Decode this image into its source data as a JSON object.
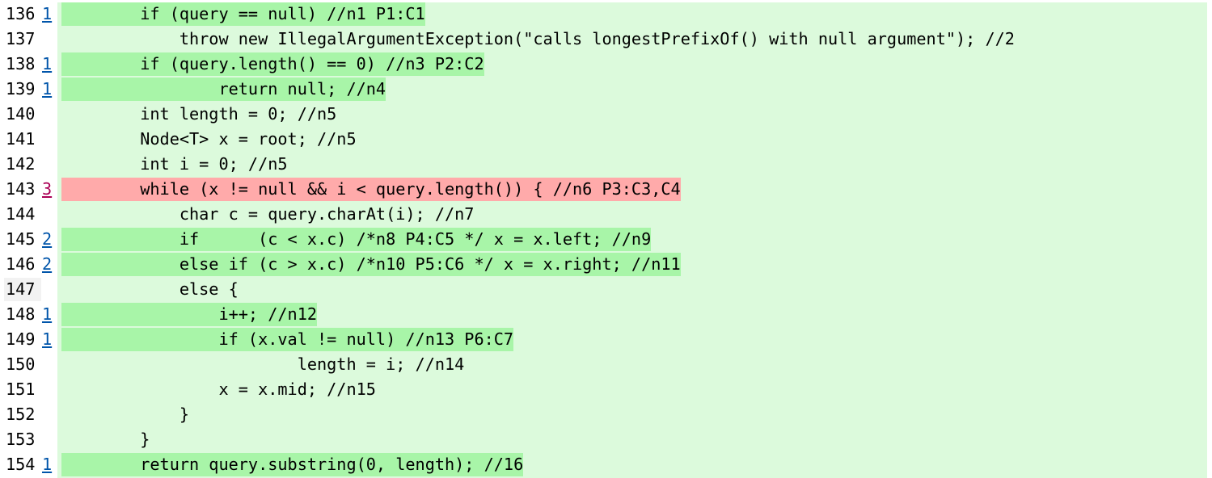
{
  "colors": {
    "line_background": "#dcfadc",
    "killed_highlight": "#a8f5a8",
    "survived_highlight": "#ffaaaa",
    "killed_link": "#0055aa",
    "survived_link": "#aa0055"
  },
  "lines": [
    {
      "number": "136",
      "mutations": "1",
      "status": "killed",
      "code": "        if (query == null) //n1 P1:C1"
    },
    {
      "number": "137",
      "mutations": "",
      "status": "none",
      "code": "            throw new IllegalArgumentException(\"calls longestPrefixOf() with null argument\"); //2"
    },
    {
      "number": "138",
      "mutations": "1",
      "status": "killed",
      "code": "        if (query.length() == 0) //n3 P2:C2"
    },
    {
      "number": "139",
      "mutations": "1",
      "status": "killed",
      "code": "                return null; //n4"
    },
    {
      "number": "140",
      "mutations": "",
      "status": "none",
      "code": "        int length = 0; //n5"
    },
    {
      "number": "141",
      "mutations": "",
      "status": "none",
      "code": "        Node<T> x = root; //n5"
    },
    {
      "number": "142",
      "mutations": "",
      "status": "none",
      "code": "        int i = 0; //n5"
    },
    {
      "number": "143",
      "mutations": "3",
      "status": "survived",
      "code": "        while (x != null && i < query.length()) { //n6 P3:C3,C4"
    },
    {
      "number": "144",
      "mutations": "",
      "status": "none",
      "code": "            char c = query.charAt(i); //n7"
    },
    {
      "number": "145",
      "mutations": "2",
      "status": "killed",
      "code": "            if      (c < x.c) /*n8 P4:C5 */ x = x.left; //n9"
    },
    {
      "number": "146",
      "mutations": "2",
      "status": "killed",
      "code": "            else if (c > x.c) /*n10 P5:C6 */ x = x.right; //n11"
    },
    {
      "number": "147",
      "mutations": "",
      "status": "none",
      "code": "            else {"
    },
    {
      "number": "148",
      "mutations": "1",
      "status": "killed",
      "code": "                i++; //n12"
    },
    {
      "number": "149",
      "mutations": "1",
      "status": "killed",
      "code": "                if (x.val != null) //n13 P6:C7"
    },
    {
      "number": "150",
      "mutations": "",
      "status": "none",
      "code": "                        length = i; //n14"
    },
    {
      "number": "151",
      "mutations": "",
      "status": "none",
      "code": "                x = x.mid; //n15"
    },
    {
      "number": "152",
      "mutations": "",
      "status": "none",
      "code": "            }"
    },
    {
      "number": "153",
      "mutations": "",
      "status": "none",
      "code": "        }"
    },
    {
      "number": "154",
      "mutations": "1",
      "status": "killed",
      "code": "        return query.substring(0, length); //16"
    }
  ]
}
